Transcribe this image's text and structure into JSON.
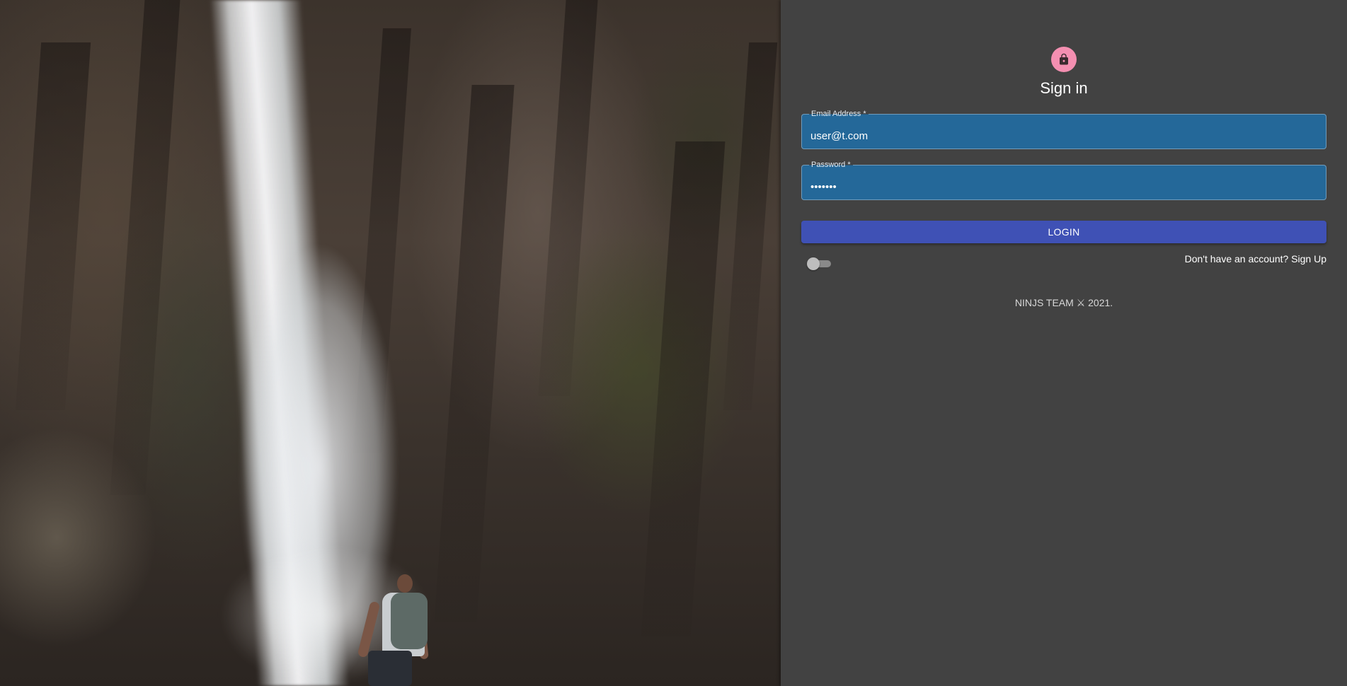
{
  "hero": {
    "image": "waterfall-hiker-photo"
  },
  "auth": {
    "icon": "lock-icon",
    "avatar_color": "#f48fb1",
    "title": "Sign in",
    "email": {
      "label": "Email Address *",
      "value": "user@t.com"
    },
    "password": {
      "label": "Password *",
      "value": "•••••••"
    },
    "login_label": "LOGIN",
    "login_color": "#3f51b5",
    "field_color": "#246899",
    "theme_toggle": {
      "checked": false
    },
    "signup_label": "Don't have an account? Sign Up"
  },
  "footer": {
    "text": "NINJS TEAM ⚔ 2021."
  }
}
